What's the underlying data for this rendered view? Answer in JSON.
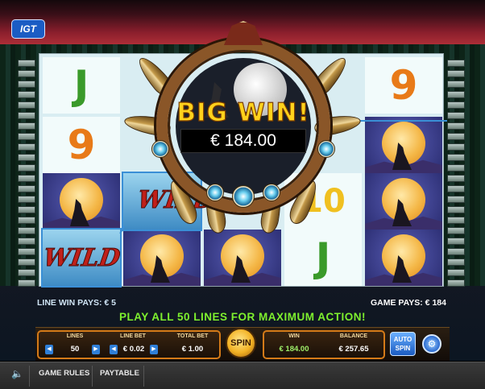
{
  "brand": {
    "logo_text": "IGT"
  },
  "symbols": {
    "wild": "WILD",
    "jack": "J",
    "nine": "9",
    "ten": "10"
  },
  "big_win": {
    "title": "BIG WIN!",
    "amount": "€ 184.00"
  },
  "info": {
    "line_win": "LINE WIN PAYS: € 5",
    "game_pays": "GAME PAYS: € 184"
  },
  "promo": "PLAY ALL 50 LINES FOR MAXIMUM ACTION!",
  "controls": {
    "lines_label": "LINES",
    "lines_value": "50",
    "line_bet_label": "LINE BET",
    "line_bet_value": "€ 0.02",
    "total_bet_label": "TOTAL BET",
    "total_bet_value": "€ 1.00",
    "spin_label": "SPIN",
    "win_label": "WIN",
    "win_value": "€ 184.00",
    "balance_label": "BALANCE",
    "balance_value": "€ 257.65",
    "autospin_line1": "AUTO",
    "autospin_line2": "SPIN",
    "left_arrow": "◀",
    "right_arrow": "▶"
  },
  "bottom_bar": {
    "game_rules": "GAME RULES",
    "paytable": "PAYTABLE",
    "speaker_glyph": "🔈"
  },
  "colors": {
    "jack": "#3a9a2a",
    "nine": "#e87a18",
    "ten": "#f0c020",
    "highlight": "#3a8fd6"
  }
}
